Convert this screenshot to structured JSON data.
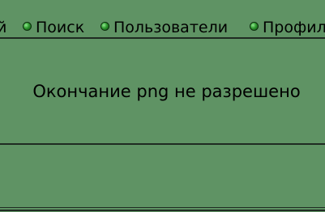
{
  "nav": {
    "items": [
      {
        "label": "й",
        "icon": "bullet-icon"
      },
      {
        "label": "Поиск",
        "icon": "bullet-icon"
      },
      {
        "label": "Пользователи",
        "icon": "bullet-icon"
      },
      {
        "label": "Профил",
        "icon": "bullet-icon"
      }
    ]
  },
  "main": {
    "message": "Окончание png не разрешено"
  },
  "colors": {
    "background": "#5f9364",
    "divider": "#1f2b22",
    "text": "#000000"
  }
}
